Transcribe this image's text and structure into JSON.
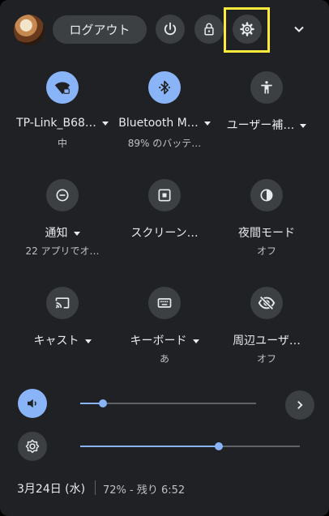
{
  "header": {
    "logout_label": "ログアウト"
  },
  "colors": {
    "accent": "#8ab4f8",
    "panel_bg": "#202124",
    "button_bg": "#3c4043",
    "highlight": "#ffeb3b"
  },
  "tiles": [
    {
      "label": "TP-Link_B68…",
      "sub": "中",
      "icon": "wifi-lock-icon",
      "active": true,
      "has_menu": true
    },
    {
      "label": "Bluetooth M…",
      "sub": "89% のバッテ…",
      "icon": "bluetooth-icon",
      "active": true,
      "has_menu": true
    },
    {
      "label": "ユーザー補…",
      "sub": "",
      "icon": "accessibility-icon",
      "active": false,
      "has_menu": true
    },
    {
      "label": "通知",
      "sub": "22 アプリでオ…",
      "icon": "notifications-icon",
      "active": false,
      "has_menu": true
    },
    {
      "label": "スクリーン…",
      "sub": "",
      "icon": "screen-capture-icon",
      "active": false,
      "has_menu": false
    },
    {
      "label": "夜間モード",
      "sub": "オフ",
      "icon": "night-light-icon",
      "active": false,
      "has_menu": false
    },
    {
      "label": "キャスト",
      "sub": "",
      "icon": "cast-icon",
      "active": false,
      "has_menu": true
    },
    {
      "label": "キーボード",
      "sub": "あ",
      "icon": "keyboard-icon",
      "active": false,
      "has_menu": true
    },
    {
      "label": "周辺ユーザ…",
      "sub": "オフ",
      "icon": "nearby-visibility-off-icon",
      "active": false,
      "has_menu": false
    }
  ],
  "sliders": {
    "volume_level": 0.13,
    "brightness_level": 0.63
  },
  "footer": {
    "date": "3月24日 (水)",
    "battery": "72% - 残り 6:52"
  }
}
